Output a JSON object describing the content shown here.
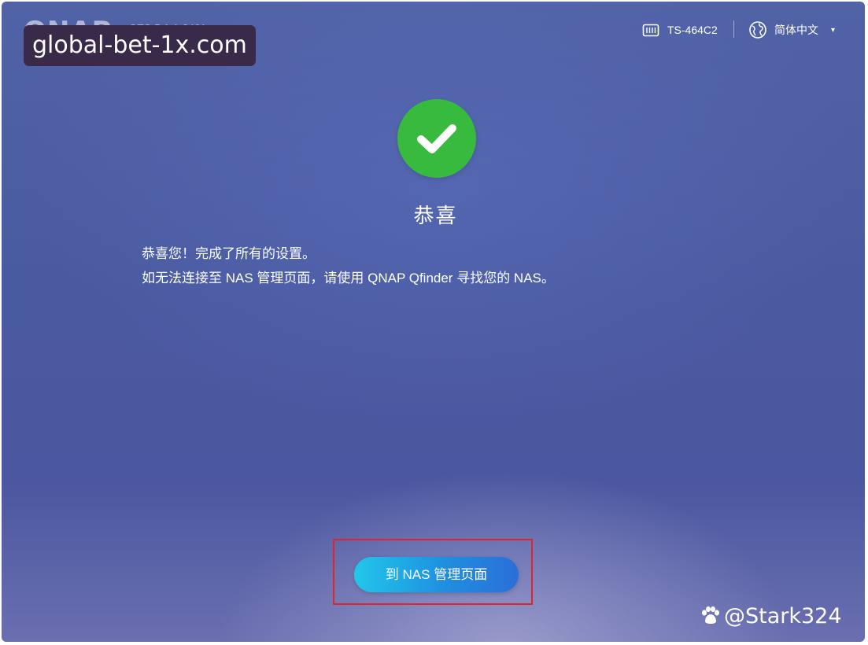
{
  "header": {
    "brand": "QNAP",
    "os_version": "QTS 5.1.1.2491",
    "device_icon": "nas-device-icon",
    "device_name": "TS-464C2",
    "language_icon": "globe-icon",
    "language": "简体中文",
    "language_caret": "▾"
  },
  "overlay": {
    "watermark": "global-bet-1x.com",
    "credit": "@Stark324"
  },
  "main": {
    "status_icon": "check-icon",
    "status_color": "#38ba3e",
    "title": "恭喜",
    "message_line1": "恭喜您！完成了所有的设置。",
    "message_line2": "如无法连接至 NAS 管理页面，请使用 QNAP Qfinder 寻找您的 NAS。",
    "primary_button": "到 NAS 管理页面"
  },
  "colors": {
    "background": "#4b5aa3",
    "accent_button": "#1f8fe0",
    "highlight_border": "#e0242e"
  }
}
